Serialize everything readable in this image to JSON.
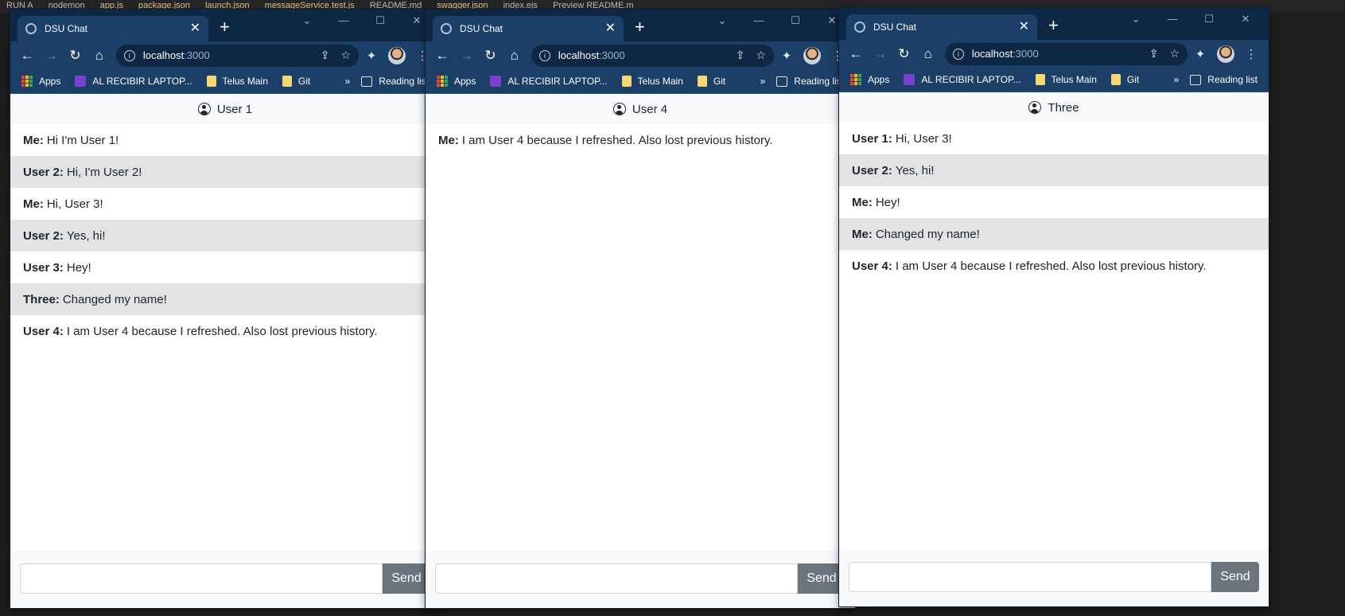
{
  "background": {
    "top_tabs": [
      "RUN A",
      "nodemon",
      "app.js",
      "package.json",
      "launch.json",
      "messageService.test.js",
      "README.md",
      "swagger.json",
      "index.ejs",
      "Preview README.m"
    ]
  },
  "windows": [
    {
      "tab_title": "DSU Chat",
      "url_host": "localhost",
      "url_port": ":3000",
      "bookmarks": [
        "Apps",
        "AL RECIBIR LAPTOP...",
        "Telus Main",
        "Git"
      ],
      "bookmarks_more": "»",
      "reading_list": "Reading list",
      "header_name": "User 1",
      "messages": [
        {
          "sender": "Me:",
          "text": "Hi I'm User 1!"
        },
        {
          "sender": "User 2:",
          "text": "Hi, I'm User 2!"
        },
        {
          "sender": "Me:",
          "text": "Hi, User 3!"
        },
        {
          "sender": "User 2:",
          "text": "Yes, hi!"
        },
        {
          "sender": "User 3:",
          "text": "Hey!"
        },
        {
          "sender": "Three:",
          "text": "Changed my name!"
        },
        {
          "sender": "User 4:",
          "text": "I am User 4 because I refreshed. Also lost previous history."
        }
      ],
      "send_label": "Send",
      "input_value": ""
    },
    {
      "tab_title": "DSU Chat",
      "url_host": "localhost",
      "url_port": ":3000",
      "bookmarks": [
        "Apps",
        "AL RECIBIR LAPTOP...",
        "Telus Main",
        "Git"
      ],
      "bookmarks_more": "»",
      "reading_list": "Reading list",
      "header_name": "User 4",
      "messages": [
        {
          "sender": "Me:",
          "text": "I am User 4 because I refreshed. Also lost previous history."
        }
      ],
      "send_label": "Send",
      "input_value": ""
    },
    {
      "tab_title": "DSU Chat",
      "url_host": "localhost",
      "url_port": ":3000",
      "bookmarks": [
        "Apps",
        "AL RECIBIR LAPTOP...",
        "Telus Main",
        "Git"
      ],
      "bookmarks_more": "»",
      "reading_list": "Reading list",
      "header_name": "Three",
      "messages": [
        {
          "sender": "User 1:",
          "text": "Hi, User 3!"
        },
        {
          "sender": "User 2:",
          "text": "Yes, hi!"
        },
        {
          "sender": "Me:",
          "text": "Hey!"
        },
        {
          "sender": "Me:",
          "text": "Changed my name!"
        },
        {
          "sender": "User 4:",
          "text": "I am User 4 because I refreshed. Also lost previous history."
        }
      ],
      "send_label": "Send",
      "input_value": ""
    }
  ],
  "colors": {
    "tabbar": "#0d2745",
    "toolbar": "#1b3f66",
    "alt_row": "#e2e3e5",
    "send_button": "#6c757d"
  }
}
